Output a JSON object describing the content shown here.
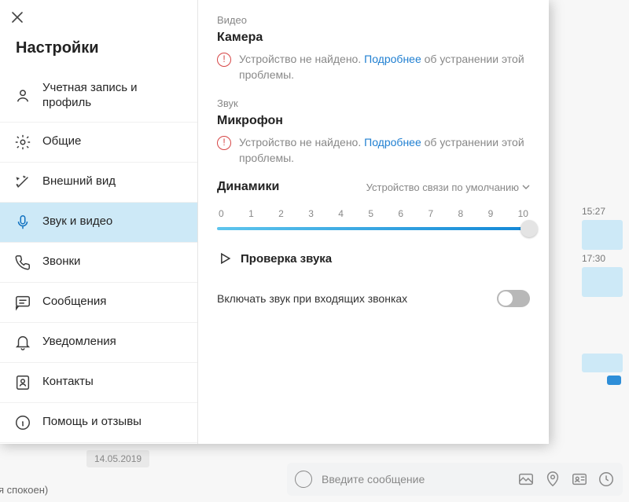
{
  "sidebar": {
    "title": "Настройки",
    "items": [
      {
        "label": "Учетная запись и профиль",
        "icon": "person"
      },
      {
        "label": "Общие",
        "icon": "gear"
      },
      {
        "label": "Внешний вид",
        "icon": "wand"
      },
      {
        "label": "Звук и видео",
        "icon": "mic"
      },
      {
        "label": "Звонки",
        "icon": "phone"
      },
      {
        "label": "Сообщения",
        "icon": "message"
      },
      {
        "label": "Уведомления",
        "icon": "bell"
      },
      {
        "label": "Контакты",
        "icon": "contacts"
      },
      {
        "label": "Помощь и отзывы",
        "icon": "info"
      }
    ],
    "active_index": 3
  },
  "content": {
    "video_label": "Видео",
    "camera_title": "Камера",
    "camera_warn_pre": "Устройство не найдено.",
    "camera_warn_link": "Подробнее",
    "camera_warn_post": "об устранении этой проблемы.",
    "audio_label": "Звук",
    "mic_title": "Микрофон",
    "mic_warn_pre": "Устройство не найдено.",
    "mic_warn_link": "Подробнее",
    "mic_warn_post": "об устранении этой проблемы.",
    "speakers_title": "Динамики",
    "speakers_device": "Устройство связи по умолчанию",
    "slider_ticks": [
      "0",
      "1",
      "2",
      "3",
      "4",
      "5",
      "6",
      "7",
      "8",
      "9",
      "10"
    ],
    "slider_value": 10,
    "test_label": "Проверка звука",
    "unmute_label": "Включать звук при входящих звонках",
    "unmute_on": false
  },
  "background": {
    "time1": "15:27",
    "time2": "17:30",
    "date": "14.05.2019",
    "status": "я спокоен)",
    "composer_placeholder": "Введите сообщение"
  }
}
